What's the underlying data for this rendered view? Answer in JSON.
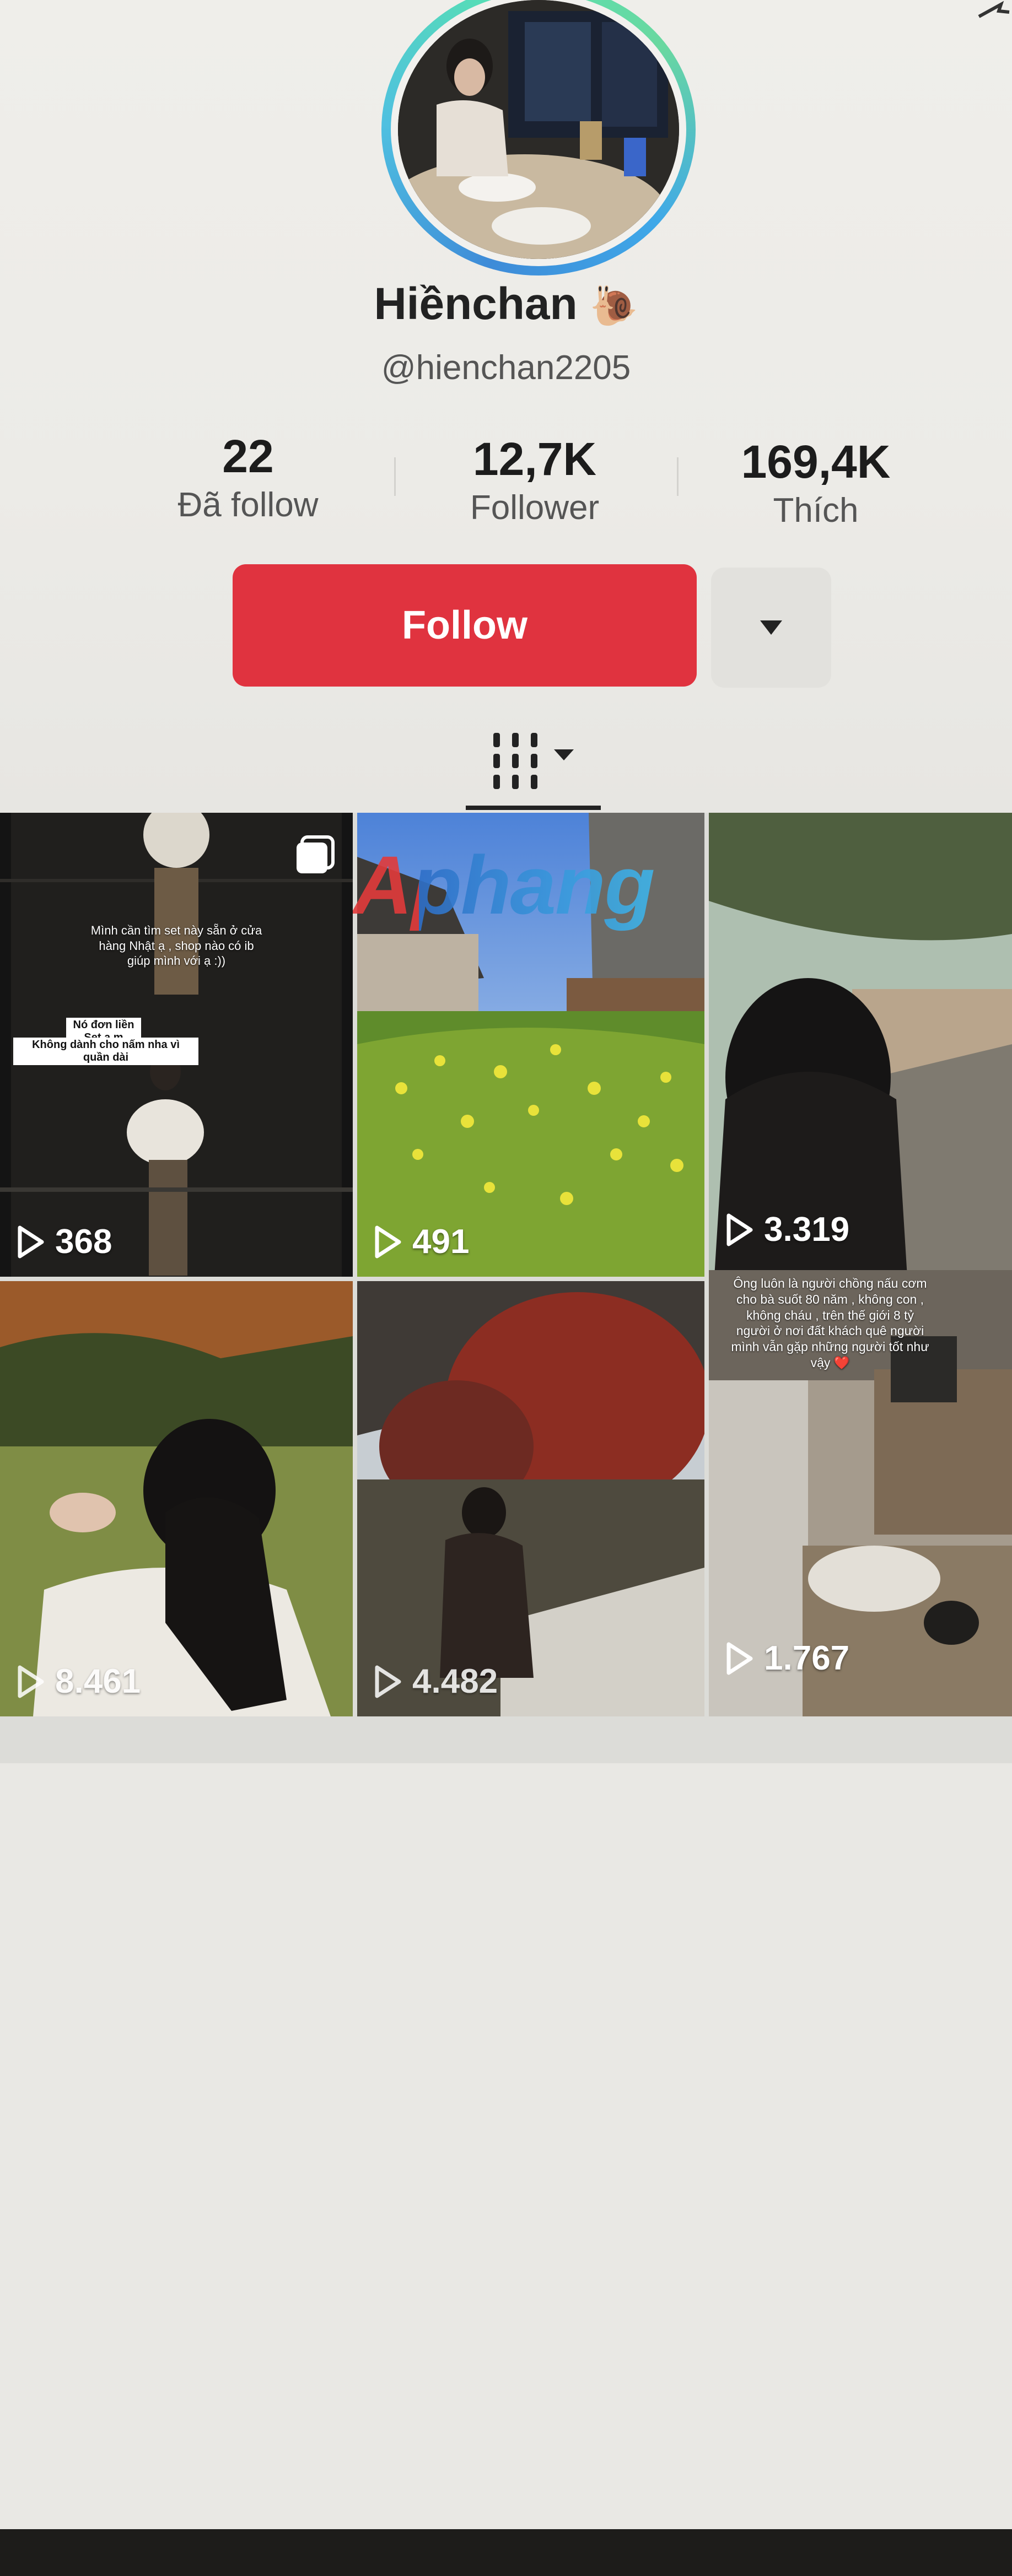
{
  "profile": {
    "display_name": "Hiềnchan",
    "name_emoji": "🐌",
    "handle": "@hienchan2205",
    "stats": [
      {
        "value": "22",
        "label": "Đã follow"
      },
      {
        "value": "12,7K",
        "label": "Follower"
      },
      {
        "value": "169,4K",
        "label": "Thích"
      }
    ],
    "follow_label": "Follow"
  },
  "colors": {
    "follow_button": "#e0333f",
    "avatar_ring": "#4fc0e0"
  },
  "watermark": "Aphang",
  "videos": [
    {
      "views": "368",
      "caption": "Mình cần tìm set này sẵn ở cửa hàng Nhật ạ , shop nào có ib giúp mình với ạ :))",
      "tag_line1": "Nó đơn liền Set ạ,m",
      "tag_line2": "Không dành cho nấm nha vì quần dài"
    },
    {
      "views": "491"
    },
    {
      "views": "3.319"
    },
    {
      "views": "8.461"
    },
    {
      "views": "4.482"
    },
    {
      "views": "1.767",
      "caption": "Ông luôn là người chồng nấu cơm cho bà suốt 80 năm , không con , không cháu , trên thế giới 8 tỷ người ở nơi đất khách quê người mình vẫn gặp những người tốt như vậy ❤️"
    }
  ]
}
